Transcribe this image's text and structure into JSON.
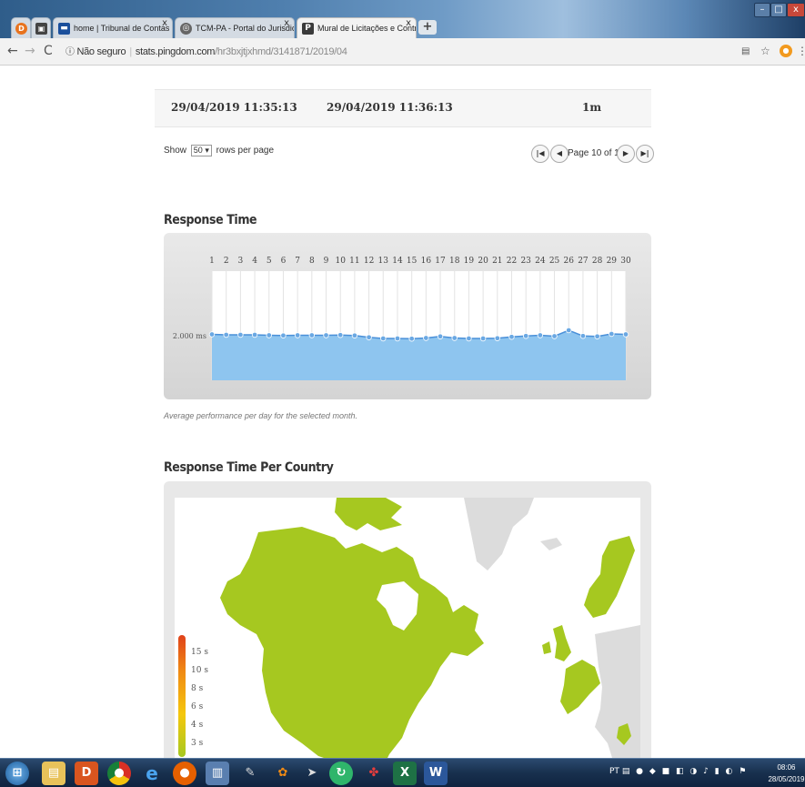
{
  "browser": {
    "tabs": [
      {
        "label": "home | Tribunal de Contas dos M",
        "icon": "tce-favicon",
        "color": "#1a4f9c"
      },
      {
        "label": "TCM-PA - Portal do Jurisdicionad",
        "icon": "globe-icon",
        "color": "#555555"
      },
      {
        "label": "Mural de Licitações e Contratos",
        "icon": "pingdom-favicon",
        "color": "#3a3a3a"
      }
    ],
    "new_tab_label": "+",
    "security_label": "Não seguro",
    "url_host": "stats.pingdom.com",
    "url_path": "/hr3bxjtjxhmd/3141871/2019/04"
  },
  "summary_row": {
    "start": "29/04/2019 11:35:13",
    "end": "29/04/2019 11:36:13",
    "duration": "1m"
  },
  "pagination": {
    "show_label": "Show",
    "rows_value": "50",
    "rows_suffix": "rows per page",
    "page_label": "Page 10 of 11"
  },
  "response_time": {
    "heading": "Response Time",
    "caption": "Average performance per day for the selected month.",
    "ytick_label": "2.000 ms"
  },
  "chart_data": {
    "type": "area",
    "title": "Response Time",
    "categories": [
      "1",
      "2",
      "3",
      "4",
      "5",
      "6",
      "7",
      "8",
      "9",
      "10",
      "11",
      "12",
      "13",
      "14",
      "15",
      "16",
      "17",
      "18",
      "19",
      "20",
      "21",
      "22",
      "23",
      "24",
      "25",
      "26",
      "27",
      "28",
      "29",
      "30"
    ],
    "ytick": {
      "label": "2.000 ms",
      "value": 2000
    },
    "ylim": [
      1000,
      3400
    ],
    "series": [
      {
        "values": [
          2010,
          2000,
          2000,
          2000,
          1990,
          1985,
          1990,
          1990,
          1990,
          1995,
          1985,
          1945,
          1920,
          1920,
          1915,
          1930,
          1965,
          1930,
          1920,
          1920,
          1925,
          1955,
          1975,
          1990,
          1970,
          2100,
          1975,
          1965,
          2020,
          2010
        ]
      }
    ],
    "colors": {
      "fill": "#8ec5ef",
      "line": "#4a90d9",
      "marker": "#6aa8e3"
    }
  },
  "response_time_country": {
    "heading": "Response Time Per Country",
    "legend": [
      "15 s",
      "10 s",
      "8 s",
      "6 s",
      "4 s",
      "3 s"
    ],
    "colors": {
      "fast": "#a6c820",
      "ocean": "#ffffff",
      "nodata": "#dcdcdc"
    }
  },
  "taskbar": {
    "language": "PT",
    "clock_time": "08:06",
    "clock_date": "28/05/2019"
  }
}
